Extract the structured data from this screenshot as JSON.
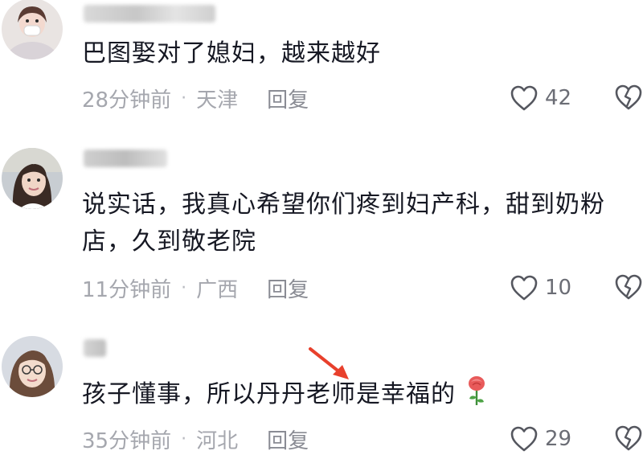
{
  "comments": [
    {
      "text": "巴图娶对了媳妇，越来越好",
      "time": "28分钟前",
      "separator": "·",
      "location": "天津",
      "reply_label": "回复",
      "likes": "42"
    },
    {
      "text": "说实话，我真心希望你们疼到妇产科，甜到奶粉店，久到敬老院",
      "time": "11分钟前",
      "separator": "·",
      "location": "广西",
      "reply_label": "回复",
      "likes": "10"
    },
    {
      "text": "孩子懂事，所以丹丹老师是幸福的",
      "time": "35分钟前",
      "separator": "·",
      "location": "河北",
      "reply_label": "回复",
      "likes": "29"
    }
  ],
  "icons": {
    "like": "heart-outline-icon",
    "dislike": "broken-heart-icon",
    "annotation": "red-arrow-icon",
    "emoji": "rose-emoji-icon"
  },
  "colors": {
    "text": "#161823",
    "meta": "#a5a7ae",
    "annotation_arrow": "#e8402c",
    "rose": "#e85a5a"
  }
}
